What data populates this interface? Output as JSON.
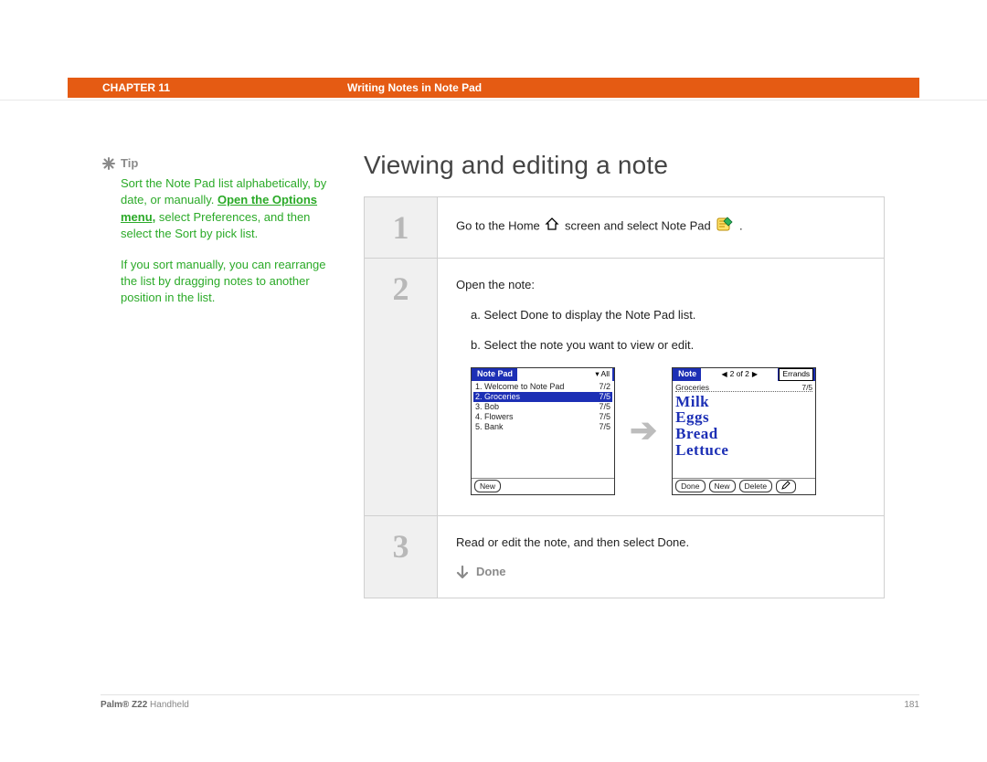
{
  "header": {
    "chapter": "CHAPTER 11",
    "section": "Writing Notes in Note Pad"
  },
  "sidebar": {
    "tip_label": "Tip",
    "tip_p1a": "Sort the Note Pad list alphabetically, by date, or manually. ",
    "tip_link": "Open the Options menu,",
    "tip_p1b": " select Preferences, and then select the Sort by pick list.",
    "tip_p2": "If you sort manually, you can rearrange the list by dragging notes to another position in the list."
  },
  "main": {
    "title": "Viewing and editing a note",
    "step1": {
      "num": "1",
      "text_a": "Go to the Home ",
      "text_b": " screen and select Note Pad ",
      "text_c": "."
    },
    "step2": {
      "num": "2",
      "intro": "Open the note:",
      "sub_a": "a.  Select Done to display the Note Pad list.",
      "sub_b": "b.  Select the note you want to view or edit.",
      "list_screen": {
        "title": "Note Pad",
        "category": "▾ All",
        "rows": [
          {
            "t": "1. Welcome to Note Pad",
            "d": "7/2",
            "sel": false
          },
          {
            "t": "2. Groceries",
            "d": "7/5",
            "sel": true
          },
          {
            "t": "3. Bob",
            "d": "7/5",
            "sel": false
          },
          {
            "t": "4. Flowers",
            "d": "7/5",
            "sel": false
          },
          {
            "t": "5. Bank",
            "d": "7/5",
            "sel": false
          }
        ],
        "btn_new": "New"
      },
      "note_screen": {
        "title": "Note",
        "pager": "2 of 2",
        "category": "Errands",
        "meta_name": "Groceries",
        "meta_date": "7/5",
        "hand1": "Milk",
        "hand2": "Eggs",
        "hand3": "Bread",
        "hand4": "Lettuce",
        "btn_done": "Done",
        "btn_new": "New",
        "btn_delete": "Delete"
      }
    },
    "step3": {
      "num": "3",
      "text": "Read or edit the note, and then select Done.",
      "done": "Done"
    }
  },
  "footer": {
    "product_bold": "Palm® Z22",
    "product_rest": " Handheld",
    "page": "181"
  }
}
